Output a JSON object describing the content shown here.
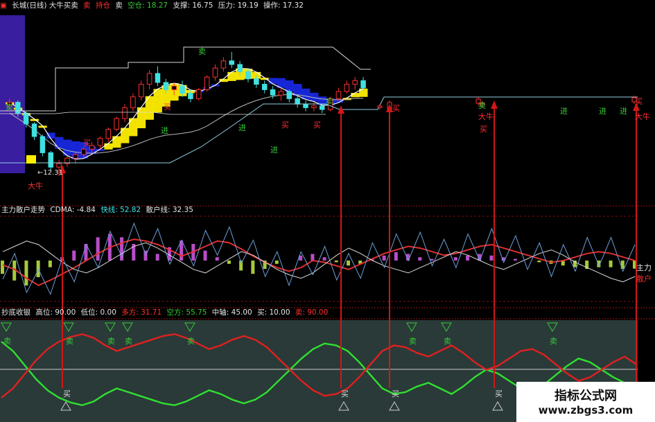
{
  "panel1": {
    "header": {
      "title": "长城(日线) 大牛买卖",
      "sell_marker": "卖",
      "hold_label": "持仓",
      "sell_label": "卖",
      "empty_label": "空仓: 18.27",
      "support_label": "支撑: 16.75",
      "pressure_label": "压力: 19.19",
      "operation_label": "操作: 17.32"
    },
    "low_price_label": "←12.31",
    "annotations": [
      {
        "text": "卖",
        "color": "#38c838"
      },
      {
        "text": "进",
        "color": "#38c838"
      },
      {
        "text": "买",
        "color": "#ff3030"
      },
      {
        "text": "买",
        "color": "#ff3030"
      },
      {
        "text": "卖",
        "color": "#38c838"
      },
      {
        "text": "买",
        "color": "#ff3030"
      },
      {
        "text": "卖",
        "color": "#38c838"
      },
      {
        "text": "进",
        "color": "#38c838"
      },
      {
        "text": "进",
        "color": "#38c838"
      },
      {
        "text": "买",
        "color": "#ff3030"
      },
      {
        "text": "买",
        "color": "#ff3030"
      },
      {
        "text": "卖",
        "color": "#38c838"
      },
      {
        "text": "买",
        "color": "#ff3030"
      },
      {
        "text": "大牛",
        "color": "#ff3030"
      },
      {
        "text": "进",
        "color": "#38c838"
      },
      {
        "text": "进",
        "color": "#38c838"
      },
      {
        "text": "进",
        "color": "#38c838"
      },
      {
        "text": "买",
        "color": "#ff3030"
      },
      {
        "text": "大牛",
        "color": "#ff3030"
      }
    ]
  },
  "panel2": {
    "header": {
      "title": "主力散户走势",
      "cdma_label": "CDMA: -4.84",
      "fast_label": "快线: 52.82",
      "retail_label": "散户线: 32.35"
    },
    "right_labels": [
      "主力",
      "散户"
    ]
  },
  "panel3": {
    "header": {
      "title": "抄底收银",
      "high_label": "高位: 90.00",
      "low_label": "低位: 0.00",
      "bull_label": "多方: 31.71",
      "bear_label": "空方: 55.75",
      "mid_label": "中轴: 45.00",
      "buy_label": "买: 10.00",
      "sell_label": "卖: 90.00"
    },
    "labels": [
      {
        "text": "卖",
        "color": "#38c838"
      },
      {
        "text": "卖",
        "color": "#38c838"
      },
      {
        "text": "卖",
        "color": "#38c838"
      },
      {
        "text": "卖",
        "color": "#38c838"
      },
      {
        "text": "卖",
        "color": "#38c838"
      },
      {
        "text": "卖",
        "color": "#38c838"
      },
      {
        "text": "卖",
        "color": "#38c838"
      },
      {
        "text": "卖",
        "color": "#38c838"
      },
      {
        "text": "买",
        "color": "#dddddd"
      },
      {
        "text": "买",
        "color": "#dddddd"
      },
      {
        "text": "买",
        "color": "#dddddd"
      },
      {
        "text": "买",
        "color": "#dddddd"
      }
    ]
  },
  "watermark": {
    "title": "指标公式网",
    "url": "www.zbgs3.com"
  },
  "colors": {
    "background": "#000000",
    "band": "#3a1ea0",
    "up": "#ff3030",
    "down": "#40e0e0",
    "bull_line": "#30e030",
    "bear_line": "#e02020",
    "yellow": "#ffee00",
    "blue": "#1828e0",
    "magenta": "#cc55dd",
    "arrow": "#d01818"
  },
  "chart_data": [
    {
      "type": "candlestick",
      "title": "长城(日线) 大牛买卖",
      "y_range": [
        12,
        21
      ],
      "candles": [
        [
          16.2,
          16.6,
          15.9,
          16.4
        ],
        [
          16.4,
          16.5,
          15.6,
          15.8
        ],
        [
          15.8,
          15.9,
          15.0,
          15.2
        ],
        [
          15.2,
          15.3,
          14.3,
          14.5
        ],
        [
          14.5,
          14.6,
          13.4,
          13.6
        ],
        [
          13.6,
          13.7,
          12.6,
          12.8
        ],
        [
          12.8,
          13.2,
          12.3,
          13.0
        ],
        [
          13.0,
          13.4,
          12.8,
          13.3
        ],
        [
          13.3,
          13.6,
          13.0,
          13.5
        ],
        [
          13.5,
          13.9,
          13.3,
          13.8
        ],
        [
          13.8,
          14.2,
          13.6,
          14.0
        ],
        [
          14.0,
          14.5,
          13.8,
          14.4
        ],
        [
          14.4,
          15.0,
          14.2,
          14.9
        ],
        [
          14.9,
          15.6,
          14.8,
          15.5
        ],
        [
          15.5,
          16.3,
          15.3,
          16.1
        ],
        [
          16.1,
          16.9,
          15.9,
          16.7
        ],
        [
          16.7,
          17.6,
          16.5,
          17.4
        ],
        [
          17.4,
          18.2,
          17.1,
          18.0
        ],
        [
          18.0,
          18.4,
          17.3,
          17.5
        ],
        [
          17.5,
          17.7,
          16.9,
          17.1
        ],
        [
          17.1,
          17.5,
          16.8,
          17.3
        ],
        [
          17.3,
          17.6,
          16.7,
          16.9
        ],
        [
          16.9,
          17.1,
          16.4,
          16.6
        ],
        [
          16.6,
          17.2,
          16.5,
          17.1
        ],
        [
          17.1,
          17.9,
          17.0,
          17.8
        ],
        [
          17.8,
          18.5,
          17.6,
          18.3
        ],
        [
          18.3,
          18.9,
          18.1,
          18.7
        ],
        [
          18.7,
          19.2,
          18.3,
          18.5
        ],
        [
          18.5,
          18.7,
          17.9,
          18.1
        ],
        [
          18.1,
          18.3,
          17.5,
          17.7
        ],
        [
          17.7,
          17.9,
          17.2,
          17.4
        ],
        [
          17.4,
          17.6,
          16.9,
          17.1
        ],
        [
          17.1,
          17.3,
          16.6,
          16.8
        ],
        [
          16.8,
          17.2,
          16.5,
          17.0
        ],
        [
          17.0,
          17.1,
          16.4,
          16.6
        ],
        [
          16.6,
          16.8,
          16.1,
          16.3
        ],
        [
          16.3,
          16.5,
          15.9,
          16.1
        ],
        [
          16.1,
          16.4,
          15.9,
          16.2
        ],
        [
          16.2,
          16.3,
          15.8,
          16.0
        ],
        [
          16.0,
          16.7,
          15.9,
          16.6
        ],
        [
          16.6,
          17.2,
          16.5,
          17.0
        ],
        [
          17.0,
          17.6,
          16.9,
          17.4
        ],
        [
          17.4,
          17.8,
          17.1,
          17.6
        ],
        [
          17.6,
          17.8,
          17.0,
          17.2
        ]
      ],
      "support": 16.75,
      "pressure": 19.19,
      "operation": 17.32,
      "empty": 18.27,
      "low_point": 12.31
    },
    {
      "type": "line",
      "title": "主力散户走势",
      "y_range": [
        0,
        100
      ],
      "series": [
        {
          "name": "快线",
          "values": [
            45,
            40,
            30,
            22,
            28,
            35,
            42,
            50,
            58,
            65,
            70,
            74,
            72,
            68,
            62,
            55,
            60,
            66,
            72,
            70,
            63,
            55,
            48,
            42,
            38,
            42,
            50,
            48,
            44,
            40,
            46,
            52,
            58,
            62,
            66,
            64,
            60,
            56,
            58,
            62,
            66,
            68,
            64,
            60,
            56,
            52,
            48,
            50,
            54,
            58,
            60,
            58,
            54,
            50
          ]
        },
        {
          "name": "散户线",
          "values": [
            60,
            66,
            72,
            68,
            58,
            48,
            40,
            36,
            42,
            50,
            58,
            66,
            70,
            64,
            56,
            48,
            40,
            36,
            44,
            52,
            60,
            56,
            48,
            40,
            34,
            30,
            36,
            46,
            56,
            64,
            58,
            50,
            44,
            40,
            36,
            42,
            48,
            54,
            60,
            56,
            50,
            44,
            40,
            46,
            52,
            58,
            62,
            56,
            48,
            42,
            36,
            30,
            26,
            32
          ]
        },
        {
          "name": "CDMA",
          "values": [
            -8,
            -12,
            -15,
            -10,
            -4,
            2,
            6,
            10,
            14,
            16,
            14,
            10,
            6,
            4,
            8,
            12,
            10,
            6,
            2,
            -2,
            -6,
            -8,
            -5,
            -2,
            0,
            3,
            4,
            2,
            -1,
            -3,
            -2,
            1,
            3,
            5,
            4,
            2,
            1,
            0,
            2,
            3,
            4,
            3,
            2,
            1,
            0,
            -1,
            -2,
            -3,
            -4,
            -5,
            -4,
            -4,
            -5,
            -4.84
          ]
        }
      ]
    },
    {
      "type": "line",
      "title": "抄底收银",
      "y_range": [
        0,
        100
      ],
      "high": 90,
      "low": 0,
      "mid": 45,
      "buy": 10,
      "sell": 90,
      "series": [
        {
          "name": "多方",
          "values": [
            80,
            70,
            55,
            40,
            28,
            20,
            15,
            12,
            16,
            24,
            30,
            26,
            22,
            18,
            14,
            12,
            16,
            22,
            28,
            24,
            18,
            14,
            18,
            26,
            38,
            50,
            62,
            72,
            78,
            76,
            70,
            58,
            44,
            30,
            24,
            26,
            32,
            36,
            30,
            24,
            32,
            42,
            50,
            46,
            38,
            30,
            28,
            34,
            44,
            54,
            62,
            58,
            50,
            42,
            36,
            31.71
          ]
        },
        {
          "name": "空方",
          "values": [
            20,
            30,
            45,
            60,
            72,
            80,
            85,
            88,
            84,
            76,
            70,
            74,
            78,
            82,
            86,
            88,
            84,
            78,
            72,
            76,
            82,
            86,
            82,
            74,
            62,
            50,
            38,
            28,
            22,
            24,
            30,
            42,
            56,
            70,
            76,
            74,
            68,
            64,
            70,
            76,
            68,
            58,
            50,
            54,
            62,
            70,
            72,
            66,
            56,
            46,
            38,
            42,
            50,
            58,
            64,
            55.75
          ]
        }
      ]
    }
  ]
}
